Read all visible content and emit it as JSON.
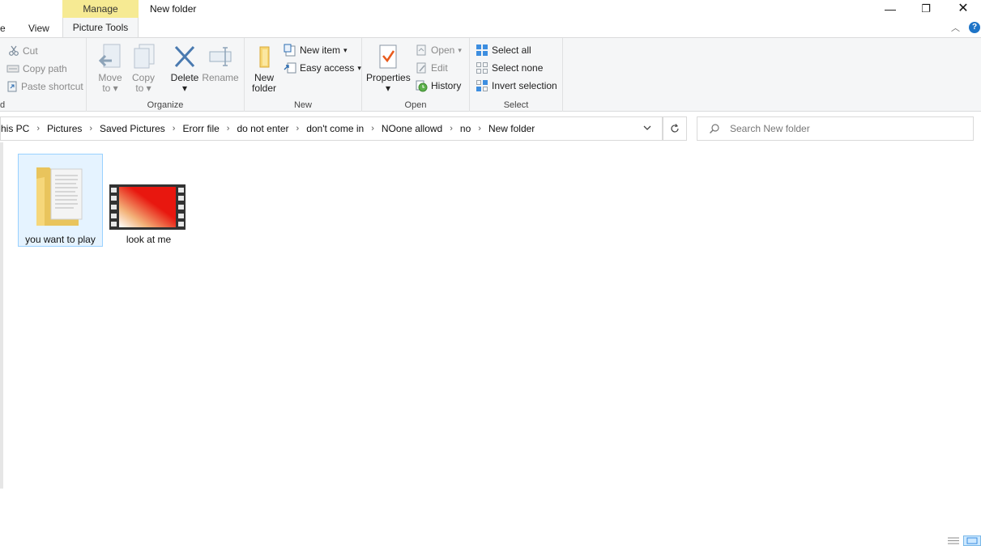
{
  "window": {
    "title": "New folder",
    "context_tab_group": "Manage",
    "tabs": [
      "e",
      "View",
      "Picture Tools"
    ],
    "controls": {
      "minimize": "—",
      "maximize": "❐",
      "close": "✕"
    },
    "help": "?",
    "collapse": "︿"
  },
  "ribbon": {
    "clipboard": {
      "cut": "Cut",
      "copy_path": "Copy path",
      "paste_shortcut": "Paste shortcut",
      "label_fragment": "d"
    },
    "organize": {
      "label": "Organize",
      "move_to": "Move",
      "move_to_2": "to",
      "copy_to": "Copy",
      "copy_to_2": "to",
      "delete": "Delete",
      "rename": "Rename"
    },
    "new": {
      "label": "New",
      "new_folder": "New",
      "new_folder_2": "folder",
      "new_item": "New item",
      "easy_access": "Easy access"
    },
    "open": {
      "label": "Open",
      "properties": "Properties",
      "open": "Open",
      "edit": "Edit",
      "history": "History"
    },
    "select": {
      "label": "Select",
      "select_all": "Select all",
      "select_none": "Select none",
      "invert_selection": "Invert selection"
    }
  },
  "address": {
    "crumbs": [
      "his PC",
      "Pictures",
      "Saved Pictures",
      "Erorr file",
      "do not enter",
      "don't come in",
      "NOone allowd",
      "no",
      "New folder"
    ],
    "separator": "›"
  },
  "search": {
    "placeholder": "Search New folder"
  },
  "files": [
    {
      "name": "you want to play",
      "type": "folder",
      "selected": true
    },
    {
      "name": "look at me",
      "type": "video",
      "selected": false
    }
  ],
  "colors": {
    "manage_band": "#f6ea93",
    "accent": "#1e74c7",
    "selection": "#e5f3ff",
    "video_thumb": "#e8170f"
  }
}
